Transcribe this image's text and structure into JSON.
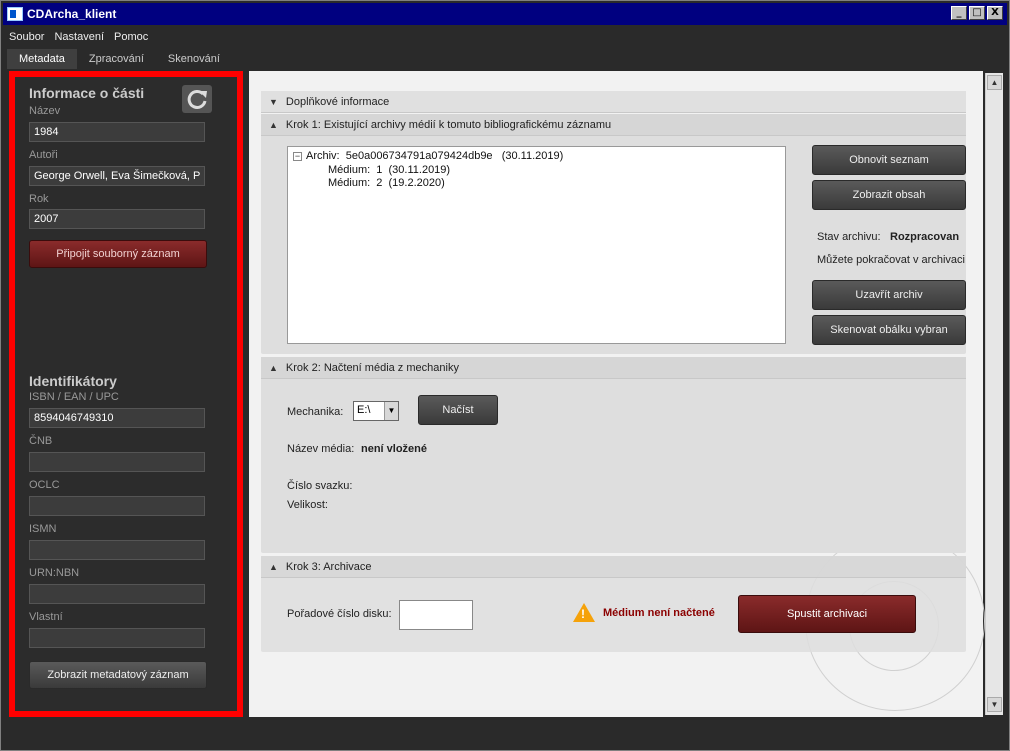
{
  "window": {
    "title": "CDArcha_klient",
    "controls": [
      "_",
      "□",
      "X"
    ]
  },
  "menu": {
    "items": [
      "Soubor",
      "Nastavení",
      "Pomoc"
    ]
  },
  "tabs": [
    "Metadata",
    "Zpracování",
    "Skenování"
  ],
  "sidebar": {
    "info_header": "Informace o části",
    "name_label": "Název",
    "name_value": "1984",
    "authors_label": "Autoři",
    "authors_value": "George Orwell,  Eva Šimečková,  P",
    "year_label": "Rok",
    "year_value": "2007",
    "attach_button": "Připojit souborný záznam",
    "identifiers_header": "Identifikátory",
    "isbn_label": "ISBN / EAN / UPC",
    "isbn_value": "8594046749310",
    "cnb_label": "ČNB",
    "cnb_value": "",
    "oclc_label": "OCLC",
    "oclc_value": "",
    "ismn_label": "ISMN",
    "ismn_value": "",
    "urn_label": "URN:NBN",
    "urn_value": "",
    "own_label": "Vlastní",
    "own_value": "",
    "show_metadata_button": "Zobrazit metadatový záznam"
  },
  "main": {
    "extra_info_header": "Doplňkové informace",
    "step1": {
      "header": "Krok 1: Existující archivy médií k tomuto bibliografickému záznamu",
      "archive_line": "Archiv:  5e0a006734791a079424db9e   (30.11.2019)",
      "media_1": "Médium:  1  (30.11.2019)",
      "media_2": "Médium:  2  (19.2.2020)",
      "refresh_list_button": "Obnovit seznam",
      "show_content_button": "Zobrazit obsah",
      "status_label": "Stav archivu:",
      "status_value": "Rozpracovan",
      "status_note": "Můžete pokračovat v archivaci",
      "close_archive_button": "Uzavřít archiv",
      "scan_cover_button": "Skenovat obálku vybran"
    },
    "step2": {
      "header": "Krok 2: Načtení média z mechaniky",
      "drive_label": "Mechanika:",
      "drive_value": "E:\\",
      "load_button": "Načíst",
      "media_name_label": "Název média:",
      "media_name_value": "není vložené",
      "volume_label": "Číslo svazku:",
      "size_label": "Velikost:"
    },
    "step3": {
      "header": "Krok 3: Archivace",
      "disc_order_label": "Pořadové číslo disku:",
      "disc_order_value": "",
      "warning_text": "Médium není načtené",
      "start_button": "Spustit archivaci"
    }
  },
  "colors": {
    "sidebar_border": "#ff0000",
    "titlebar": "#000080",
    "warning": "#8b0000",
    "accent_button": "#7a2020"
  }
}
